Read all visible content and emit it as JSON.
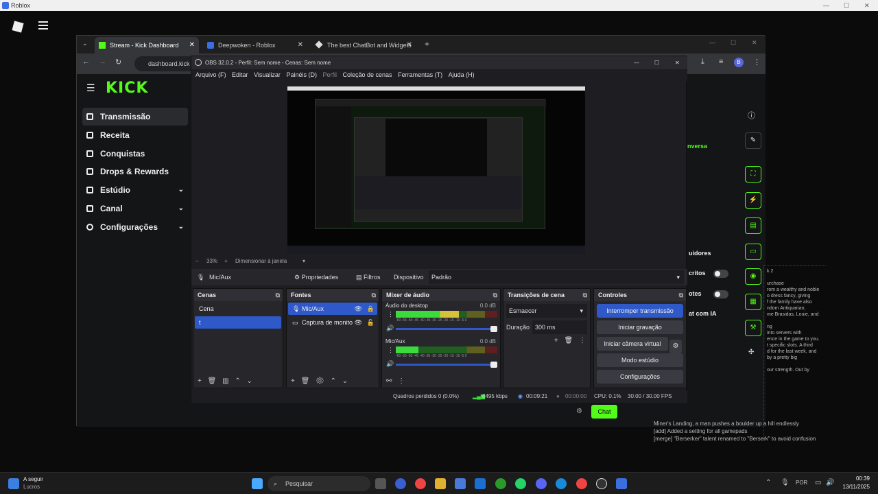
{
  "roblox": {
    "title": "Roblox"
  },
  "chrome": {
    "tabs": [
      {
        "label": "Stream - Kick Dashboard"
      },
      {
        "label": "Deepwoken - Roblox"
      },
      {
        "label": "The best ChatBot and Widgets"
      }
    ],
    "url": "dashboard.kick"
  },
  "kick": {
    "logo": "KICK",
    "nav": [
      {
        "label": "Transmissão"
      },
      {
        "label": "Receita"
      },
      {
        "label": "Conquistas"
      },
      {
        "label": "Drops & Rewards"
      },
      {
        "label": "Estúdio"
      },
      {
        "label": "Canal"
      },
      {
        "label": "Configurações"
      }
    ],
    "right_labels": {
      "conversa": "nversa",
      "seguidores": "uidores",
      "inscritos": "critos",
      "notes": "otes",
      "ia": "at com IA"
    },
    "chat_button": "Chat"
  },
  "obs": {
    "title": "OBS 32.0.2 - Perfil: Sem nome - Cenas: Sem nome",
    "menu": [
      "Arquivo (F)",
      "Editar",
      "Visualizar",
      "Painéis (D)",
      "Perfil",
      "Coleção de cenas",
      "Ferramentas (T)",
      "Ajuda (H)"
    ],
    "zoom": "33%",
    "zoom_mode": "Dimensionar à janela",
    "source_bar": {
      "source": "Mic/Aux",
      "props": "Propriedades",
      "filters": "Filtros",
      "device_label": "Dispositivo",
      "device_value": "Padrão"
    },
    "scenes": {
      "title": "Cenas",
      "items": [
        "Cena",
        "t"
      ]
    },
    "sources": {
      "title": "Fontes",
      "items": [
        "Mic/Aux",
        "Captura de monito"
      ]
    },
    "mixer": {
      "title": "Mixer de áudio",
      "channels": [
        {
          "name": "Áudio do desktop",
          "db": "0.0 dB",
          "level": 0.62
        },
        {
          "name": "Mic/Aux",
          "db": "0.0 dB",
          "level": 0.22
        }
      ],
      "scale": "-60 -55 -50 -45 -40 -35 -30 -25 -20 -15 -10 -5 0"
    },
    "transitions": {
      "title": "Transições de cena",
      "type": "Esmaecer",
      "duration_label": "Duração",
      "duration": "300 ms"
    },
    "controls": {
      "title": "Controles",
      "stop_stream": "Interromper transmissão",
      "start_rec": "Iniciar gravação",
      "virtual_cam": "Iniciar câmera virtual",
      "studio": "Modo estúdio",
      "settings": "Configurações"
    },
    "status": {
      "frames": "Quadros perdidos 0 (0.0%)",
      "bitrate": "6495 kbps",
      "live_time": "00:09:21",
      "rec_time": "00:00:00",
      "cpu": "CPU: 0.1%",
      "fps": "30.00 / 30.00 FPS"
    }
  },
  "side_text": "k 2\n\nurchase\nrom a wealthy and noble\no dress fancy, giving\nf the family have also\nndom Antiquarian,\nme Brasidas, Louie, and\n\nng\ninto servers with\nence in the game to you.\nt specific slots. A third\nd for the last week, and\nby a pretty big\n\nour strength. Out by",
  "chat_log": [
    "Miner's Landing, a man pushes a boulder up a hill endlessly",
    "[add] Added a setting for all gamepads",
    "[merge] \"Berserker\" talent renamed to \"Berserk\" to avoid confusion"
  ],
  "taskbar": {
    "weather_title": "A seguir",
    "weather_sub": "Lucros",
    "search": "Pesquisar",
    "lang": "POR",
    "time": "00:39",
    "date": "13/11/2025"
  },
  "colors": {
    "kick_green": "#53fc18",
    "obs_blue": "#2f59c8"
  }
}
